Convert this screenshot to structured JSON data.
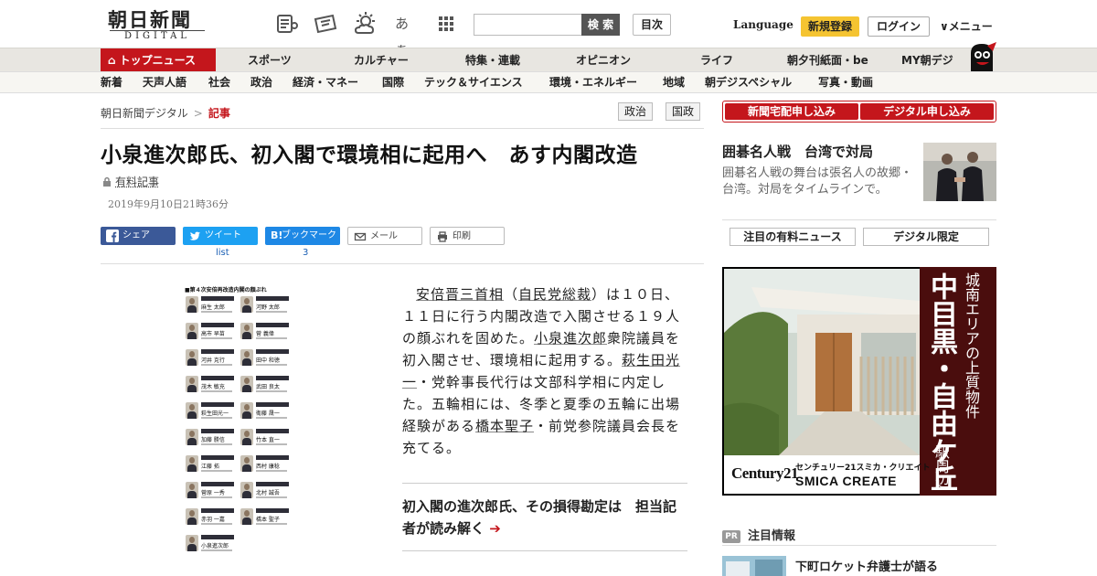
{
  "header": {
    "logo_kanji": "朝日新聞",
    "logo_sub": "DIGITAL",
    "search_button": "検 索",
    "toc_button": "目次",
    "language": "Language",
    "signup": "新規登録",
    "login": "ログイン",
    "menu": "∨メニュー",
    "icons": [
      "reader-icon",
      "coupon-icon",
      "weather-icon",
      "font-size-icon",
      "apps-grid-icon"
    ],
    "font_size_glyph": "あぁ"
  },
  "nav_primary": {
    "home": "トップニュース",
    "items": [
      "スポーツ",
      "カルチャー",
      "特集・連載",
      "オピニオン",
      "ライフ",
      "朝夕刊紙面・be",
      "MY朝デジ"
    ]
  },
  "nav_secondary": {
    "items": [
      "新着",
      "天声人語",
      "社会",
      "政治",
      "経済・マネー",
      "国際",
      "テック＆サイエンス",
      "環境・エネルギー",
      "地域",
      "朝デジスペシャル",
      "写真・動画"
    ]
  },
  "breadcrumb": {
    "home": "朝日新聞デジタル",
    "sep": ">",
    "current": "記事"
  },
  "article_tags": [
    "政治",
    "国政"
  ],
  "article": {
    "headline": "小泉進次郎氏、初入閣で環境相に起用へ　あす内閣改造",
    "paid_label": "有料記事",
    "date": "2019年9月10日21時36分",
    "body_parts": [
      {
        "t": "安倍晋三首相",
        "link": true
      },
      {
        "t": "（",
        "link": false
      },
      {
        "t": "自民党総裁",
        "link": true
      },
      {
        "t": "）は１０日、１１日に行う内閣改造で入閣させる１９人の顔ぶれを固めた。",
        "link": false
      },
      {
        "t": "小泉進次郎",
        "link": true
      },
      {
        "t": "衆院議員を初入閣させ、環境相に起用する。",
        "link": false
      },
      {
        "t": "萩生田光一",
        "link": true
      },
      {
        "t": "・党幹事長代行は文部科学相に内定した。五輪相には、冬季と夏季の五輪に出場経験がある",
        "link": false
      },
      {
        "t": "橋本聖子",
        "link": true
      },
      {
        "t": "・前党参院議員会長を充てる。",
        "link": false
      }
    ],
    "related": "初入閣の進次郎氏、その損得勘定は　担当記者が読み解く",
    "related_arrow": "➔"
  },
  "share": {
    "facebook": "シェア",
    "twitter": "ツイート",
    "twitter_count": "list",
    "hatena": "ブックマーク",
    "hatena_icon": "B!",
    "hatena_count": "3",
    "mail": "メール",
    "print": "印刷"
  },
  "figure": {
    "title": "■第４次安倍再改造内閣の顔ぶれ",
    "members": [
      "麻生 太郎",
      "河野 太郎",
      "高市 早苗",
      "菅 義偉",
      "河井 克行",
      "田中 和徳",
      "茂木 敏充",
      "武田 良太",
      "萩生田光一",
      "衛藤 晟一",
      "加藤 勝信",
      "竹本 直一",
      "江藤 拓",
      "西村 康稔",
      "菅原 一秀",
      "北村 誠吾",
      "赤羽 一嘉",
      "橋本 聖子",
      "小泉進次郎"
    ]
  },
  "sidebar": {
    "btn_home": "新聞宅配申し込み",
    "btn_digital": "デジタル申し込み",
    "feature_title": "囲碁名人戦　台湾で対局",
    "feature_text": "囲碁名人戦の舞台は張名人の故郷・台湾。対局をタイムラインで。",
    "btn_paid_news": "注目の有料ニュース",
    "btn_digital_only": "デジタル限定",
    "ad_vertical_1": "城南エリアの上質物件",
    "ad_vertical_2": "中目黒・自由ケ丘",
    "ad_vertical_3": "駅周辺",
    "ad_brand": "Century21",
    "ad_jp": "センチュリー21スミカ・クリエイト",
    "ad_en": "SMICA CREATE",
    "pr_tag": "PR",
    "pr_label": "注目情報",
    "pr_item": "下町ロケット弁護士が語る"
  },
  "colors": {
    "brand_red": "#c4161c",
    "signup_yellow": "#f5c431",
    "facebook": "#3b5998",
    "twitter": "#1da1f2",
    "hatena": "#1e88e5"
  }
}
